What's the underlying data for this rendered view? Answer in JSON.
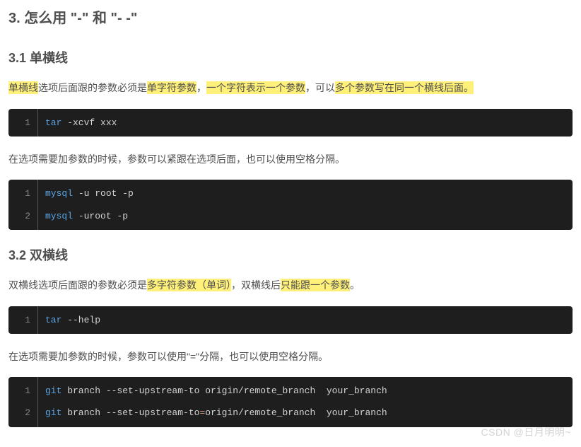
{
  "h2": "3. 怎么用 \"-\" 和 \"- -\"",
  "sec1": {
    "heading": "3.1 单横线",
    "p1": {
      "s1": "单横线",
      "s2": "选项后面跟的参数必须是",
      "s3": "单字符参数",
      "s4": "，",
      "s5": "一个字符表示一个参数",
      "s6": "，可以",
      "s7": "多个参数写在同一个横线后面。"
    },
    "code1": [
      {
        "n": "1",
        "cmd": "tar",
        "rest": " -xcvf xxx"
      }
    ],
    "p2": "在选项需要加参数的时候，参数可以紧跟在选项后面，也可以使用空格分隔。",
    "code2": [
      {
        "n": "1",
        "cmd": "mysql",
        "rest": " -u root -p"
      },
      {
        "n": "2",
        "cmd": "mysql",
        "rest": " -uroot -p"
      }
    ]
  },
  "sec2": {
    "heading": "3.2 双横线",
    "p1": {
      "s1": "双横线选项后面跟的参数必须是",
      "s2": "多字符参数（单词）",
      "s3": "，双横线后",
      "s4": "只能跟一个参数",
      "s5": "。"
    },
    "code1": [
      {
        "n": "1",
        "cmd": "tar",
        "rest": " --help"
      }
    ],
    "p2": "在选项需要加参数的时候，参数可以使用\"=\"分隔，也可以使用空格分隔。",
    "code2": [
      {
        "n": "1",
        "cmd": "git",
        "rest1": " branch --set-upstream-to origin/remote_branch  your_branch",
        "eq": ""
      },
      {
        "n": "2",
        "cmd": "git",
        "rest1": " branch --set-upstream-to",
        "eq": "=",
        "rest2": "origin/remote_branch  your_branch"
      }
    ]
  },
  "watermark": "CSDN @日月明明~"
}
